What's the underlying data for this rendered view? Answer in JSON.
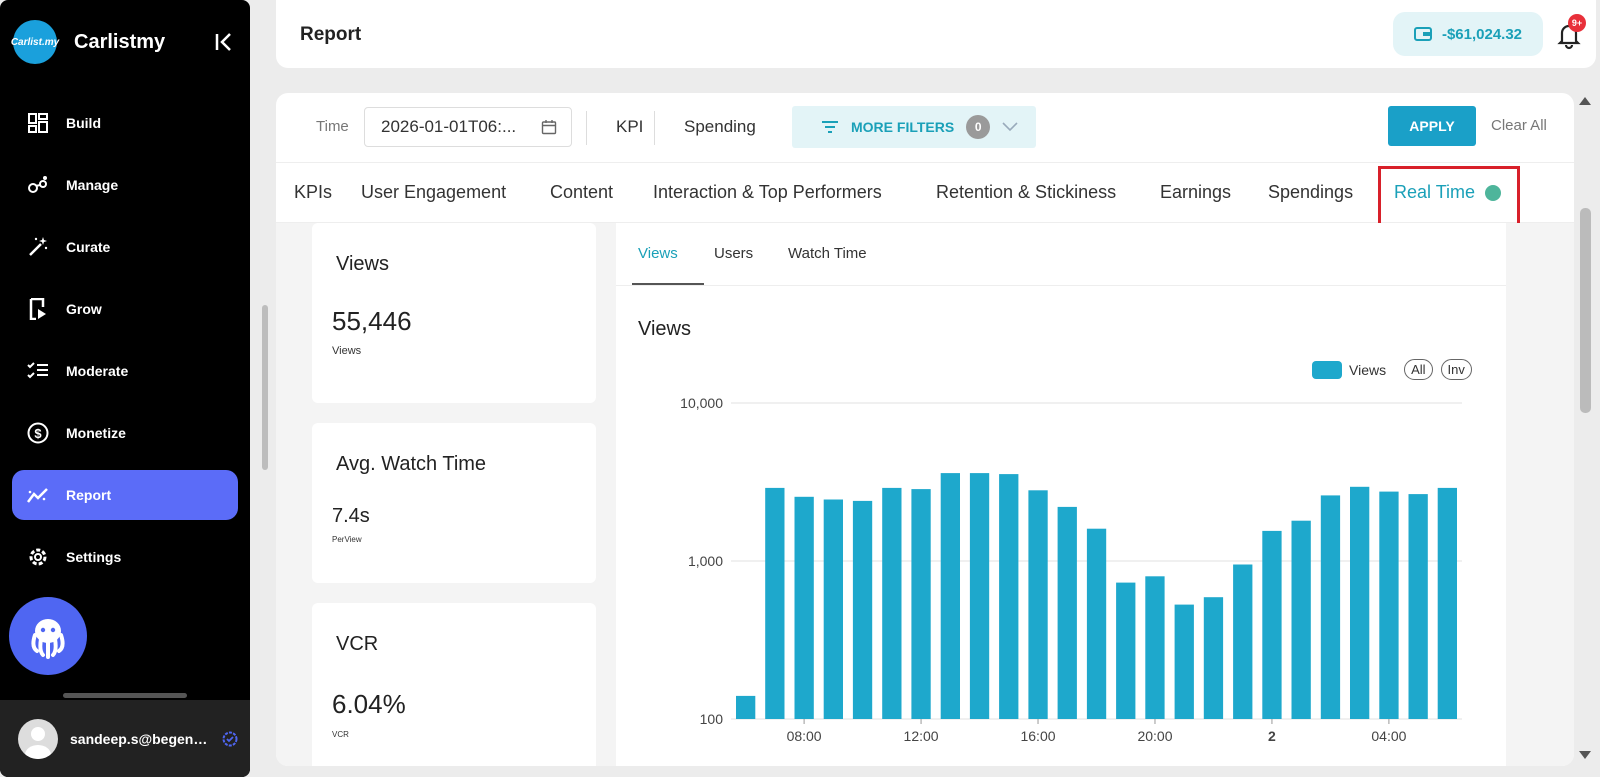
{
  "sidebar": {
    "brand": "Carlistmy",
    "logo_text": "Carlist.my",
    "items": [
      {
        "label": "Build",
        "icon": "grid-icon"
      },
      {
        "label": "Manage",
        "icon": "nodes-icon"
      },
      {
        "label": "Curate",
        "icon": "magic-wand-icon"
      },
      {
        "label": "Grow",
        "icon": "video-file-icon"
      },
      {
        "label": "Moderate",
        "icon": "checklist-icon"
      },
      {
        "label": "Monetize",
        "icon": "dollar-icon"
      },
      {
        "label": "Report",
        "icon": "trend-icon",
        "active": true
      },
      {
        "label": "Settings",
        "icon": "gear-icon"
      }
    ],
    "user_email": "sandeep.s@begenuin.com"
  },
  "header": {
    "title": "Report",
    "balance": "-$61,024.32",
    "notification_badge": "9+"
  },
  "filters": {
    "time_label": "Time",
    "time_value": "2026-01-01T06:...",
    "kpi": "KPI",
    "spending": "Spending",
    "more_filters": "MORE FILTERS",
    "more_filters_count": "0",
    "apply": "APPLY",
    "clear_all": "Clear All"
  },
  "tabs": [
    "KPIs",
    "User Engagement",
    "Content",
    "Interaction & Top Performers",
    "Retention & Stickiness",
    "Earnings",
    "Spendings",
    "Real Time"
  ],
  "kpi_cards": [
    {
      "title": "Views",
      "value": "55,446",
      "sub": "Views"
    },
    {
      "title": "Avg. Watch Time",
      "value": "7.4s",
      "sub": "PerView"
    },
    {
      "title": "VCR",
      "value": "6.04%",
      "sub": "VCR"
    }
  ],
  "chart_tabs": [
    "Views",
    "Users",
    "Watch Time"
  ],
  "chart": {
    "title": "Views",
    "legend_label": "Views",
    "legend_all": "All",
    "legend_inv": "Inv"
  },
  "chart_data": {
    "type": "bar",
    "title": "Views",
    "yscale": "log",
    "ylim": [
      100,
      10000
    ],
    "yticks": [
      "10,000",
      "1,000",
      "100"
    ],
    "xticks": [
      "08:00",
      "12:00",
      "16:00",
      "20:00",
      "2",
      "04:00"
    ],
    "series": [
      {
        "name": "Views",
        "values": [
          140,
          2900,
          2550,
          2450,
          2400,
          2900,
          2850,
          3600,
          3600,
          3550,
          2800,
          2200,
          1600,
          730,
          800,
          530,
          590,
          950,
          1550,
          1800,
          2600,
          2950,
          2750,
          2650,
          2900
        ]
      }
    ],
    "bar_color": "#1ea8cc"
  }
}
